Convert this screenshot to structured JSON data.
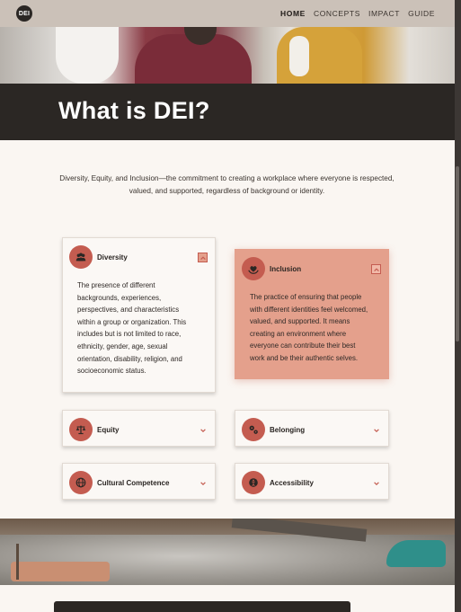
{
  "nav": {
    "logo_text": "DEI",
    "links": [
      "HOME",
      "CONCEPTS",
      "IMPACT",
      "GUIDE"
    ],
    "active": "HOME"
  },
  "hero": {
    "title": "What is DEI?"
  },
  "intro": "Diversity, Equity, and Inclusion—the commitment to creating a workplace where everyone is respected, valued, and supported, regardless of background or identity.",
  "cards": [
    {
      "title": "Diversity",
      "icon": "people-group-icon",
      "expanded": true,
      "body": "The presence of different backgrounds, experiences, perspectives, and characteristics within a group or organization. This includes but is not limited to race, ethnicity, gender, age, sexual orientation, disability, religion, and socioeconomic status."
    },
    {
      "title": "Inclusion",
      "icon": "hands-heart-icon",
      "expanded": true,
      "highlighted": true,
      "body": "The practice of ensuring that people with different identities feel welcomed, valued, and supported. It means creating an environment where everyone can contribute their best work and be their authentic selves."
    },
    {
      "title": "Equity",
      "icon": "balance-scale-icon",
      "expanded": false
    },
    {
      "title": "Belonging",
      "icon": "gears-icon",
      "expanded": false
    },
    {
      "title": "Cultural Competence",
      "icon": "globe-icon",
      "expanded": false
    },
    {
      "title": "Accessibility",
      "icon": "accessibility-icon",
      "expanded": false
    }
  ],
  "colors": {
    "accent": "#c45c50",
    "accent_light": "#e4a08c",
    "dark": "#2b2724",
    "nav_bg": "#cbc1b8",
    "page_bg": "#faf6f2"
  }
}
